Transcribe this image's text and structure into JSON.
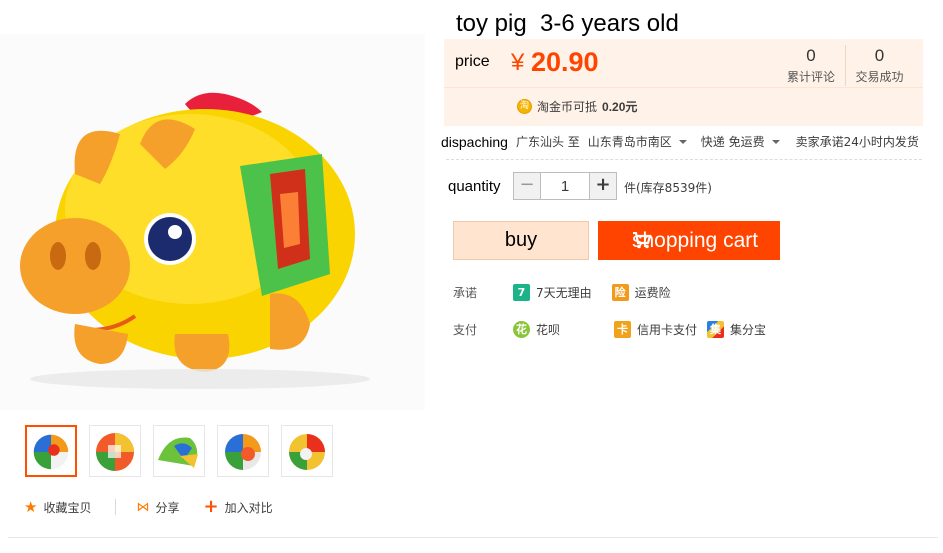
{
  "product": {
    "title": "toy pig  3-6 years old",
    "price_label": "price",
    "currency": "¥",
    "price": "20.90",
    "stats": [
      {
        "num": "0",
        "label": "累计评论"
      },
      {
        "num": "0",
        "label": "交易成功"
      }
    ],
    "coin_icon": "淘",
    "coin_text": "淘金币可抵",
    "coin_amount": "0.20元"
  },
  "dispatch": {
    "label": "dispaching",
    "from": "广东汕头 至",
    "to": "山东青岛市南区",
    "shipping": "快递 免运费",
    "promise": "卖家承诺24小时内发货"
  },
  "quantity": {
    "label": "quantity",
    "minus": "−",
    "value": "1",
    "plus": "+",
    "stock": "件(库存8539件)"
  },
  "buttons": {
    "buy": "buy",
    "cart": "shopping cart"
  },
  "services": {
    "promise_label": "承诺",
    "promise_items": [
      {
        "icon": "7",
        "text": "7天无理由"
      },
      {
        "icon": "险",
        "text": "运费险"
      }
    ],
    "pay_label": "支付",
    "pay_items": [
      {
        "icon": "花",
        "text": "花呗"
      },
      {
        "icon": "卡",
        "text": "信用卡支付"
      },
      {
        "icon": "集",
        "text": "集分宝"
      }
    ]
  },
  "gallery_actions": {
    "favorite": "收藏宝贝",
    "share": "分享",
    "compare": "加入对比"
  },
  "colors": {
    "accent": "#ff4400",
    "price_bg": "#fff2e8",
    "buy_bg": "#ffe4d0"
  },
  "icons": [
    "star-icon",
    "share-icon",
    "plus-icon",
    "cart-icon",
    "coin-icon",
    "seven-day-icon",
    "freight-insurance-icon",
    "huabei-icon",
    "credit-card-icon",
    "jifenbao-icon"
  ]
}
